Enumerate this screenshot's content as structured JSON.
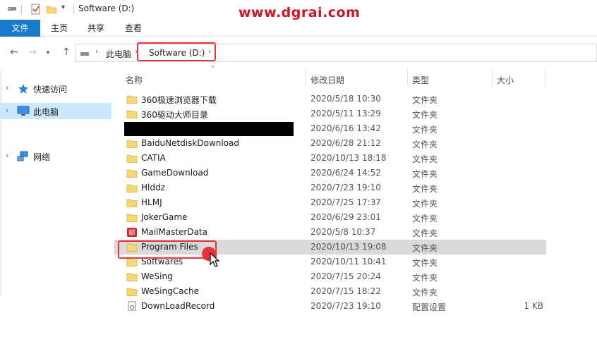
{
  "window": {
    "title": "Software (D:)"
  },
  "watermark": "www.dgrai.com",
  "ribbon": {
    "tabs": [
      "文件",
      "主页",
      "共享",
      "查看"
    ]
  },
  "address": {
    "crumbs": [
      "此电脑",
      "Software (D:)"
    ]
  },
  "nav": {
    "items": [
      {
        "label": "快速访问",
        "icon": "star-icon"
      },
      {
        "label": "此电脑",
        "icon": "computer-icon",
        "selected": true
      },
      {
        "label": "网络",
        "icon": "network-icon"
      }
    ]
  },
  "columns": {
    "name": "名称",
    "date": "修改日期",
    "type": "类型",
    "size": "大小"
  },
  "files": [
    {
      "name": "360极速浏览器下载",
      "date": "2020/5/18 10:30",
      "type": "文件夹",
      "size": "",
      "icon": "folder-icon"
    },
    {
      "name": "360驱动大师目录",
      "date": "2020/5/11 13:29",
      "type": "文件夹",
      "size": "",
      "icon": "folder-icon"
    },
    {
      "name": "",
      "date": "2020/6/16 13:42",
      "type": "文件夹",
      "size": "",
      "icon": "folder-icon",
      "redacted": true
    },
    {
      "name": "BaiduNetdiskDownload",
      "date": "2020/6/28 21:12",
      "type": "文件夹",
      "size": "",
      "icon": "folder-icon"
    },
    {
      "name": "CATIA",
      "date": "2020/10/13 18:18",
      "type": "文件夹",
      "size": "",
      "icon": "folder-icon"
    },
    {
      "name": "GameDownload",
      "date": "2020/6/24 14:52",
      "type": "文件夹",
      "size": "",
      "icon": "folder-icon"
    },
    {
      "name": "Hlddz",
      "date": "2020/7/23 19:10",
      "type": "文件夹",
      "size": "",
      "icon": "folder-icon"
    },
    {
      "name": "HLMJ",
      "date": "2020/7/25 17:37",
      "type": "文件夹",
      "size": "",
      "icon": "folder-icon"
    },
    {
      "name": "JokerGame",
      "date": "2020/6/29 23:01",
      "type": "文件夹",
      "size": "",
      "icon": "folder-icon"
    },
    {
      "name": "MailMasterData",
      "date": "2020/5/8 10:37",
      "type": "文件夹",
      "size": "",
      "icon": "mailmaster-icon"
    },
    {
      "name": "Program Files",
      "date": "2020/10/13 19:08",
      "type": "文件夹",
      "size": "",
      "icon": "folder-icon",
      "selected": true
    },
    {
      "name": "Softwares",
      "date": "2020/10/11 10:41",
      "type": "文件夹",
      "size": "",
      "icon": "folder-icon"
    },
    {
      "name": "WeSing",
      "date": "2020/7/15 20:24",
      "type": "文件夹",
      "size": "",
      "icon": "folder-icon"
    },
    {
      "name": "WeSingCache",
      "date": "2020/7/15 18:22",
      "type": "文件夹",
      "size": "",
      "icon": "folder-icon"
    },
    {
      "name": "DownLoadRecord",
      "date": "2020/7/23 19:10",
      "type": "配置设置",
      "size": "1 KB",
      "icon": "config-file-icon"
    }
  ],
  "colors": {
    "accent": "#1979ca",
    "highlight": "#e8343a",
    "selection": "#cce8ff",
    "folder": "#f8d775"
  }
}
